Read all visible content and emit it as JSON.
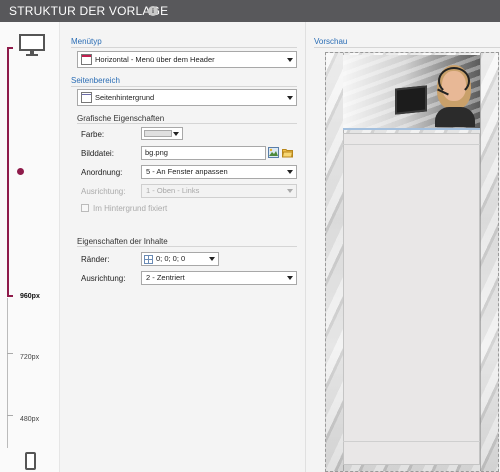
{
  "header": {
    "title": "STRUKTUR DER VORLAGE",
    "info_icon": "i"
  },
  "rail": {
    "breakpoints": [
      {
        "label": "960px",
        "active": true
      },
      {
        "label": "720px",
        "active": false
      },
      {
        "label": "480px",
        "active": false
      }
    ],
    "accent_color": "#8e1b4a"
  },
  "form": {
    "menutyp": {
      "title": "Menütyp",
      "value": "Horizontal - Menü über dem Header"
    },
    "seitenbereich": {
      "title": "Seitenbereich",
      "value": "Seitenhintergrund"
    },
    "grafische": {
      "title": "Grafische Eigenschaften",
      "farbe_label": "Farbe:",
      "bilddatei_label": "Bilddatei:",
      "bilddatei_value": "bg.png",
      "anordnung_label": "Anordnung:",
      "anordnung_value": "5 - An Fenster anpassen",
      "ausrichtung_label": "Ausrichtung:",
      "ausrichtung_value": "1 - Oben - Links",
      "fixiert_label": "Im Hintergrund fixiert"
    },
    "inhalte": {
      "title": "Eigenschaften der Inhalte",
      "raender_label": "Ränder:",
      "raender_value": "0; 0; 0; 0",
      "ausrichtung_label": "Ausrichtung:",
      "ausrichtung_value": "2 - Zentriert"
    }
  },
  "preview": {
    "title": "Vorschau"
  }
}
